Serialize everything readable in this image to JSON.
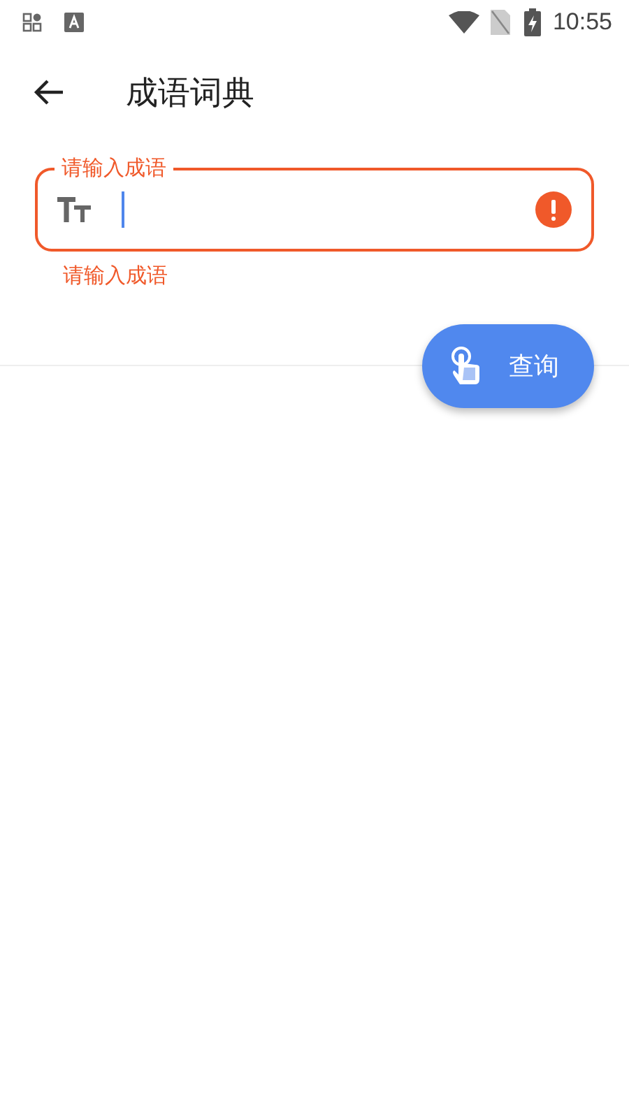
{
  "status_bar": {
    "time": "10:55"
  },
  "app_bar": {
    "title": "成语词典"
  },
  "idiom_field": {
    "label": "请输入成语",
    "focused": true,
    "error": true,
    "error_text": "请输入成语"
  },
  "query_button": {
    "label": "查询"
  }
}
